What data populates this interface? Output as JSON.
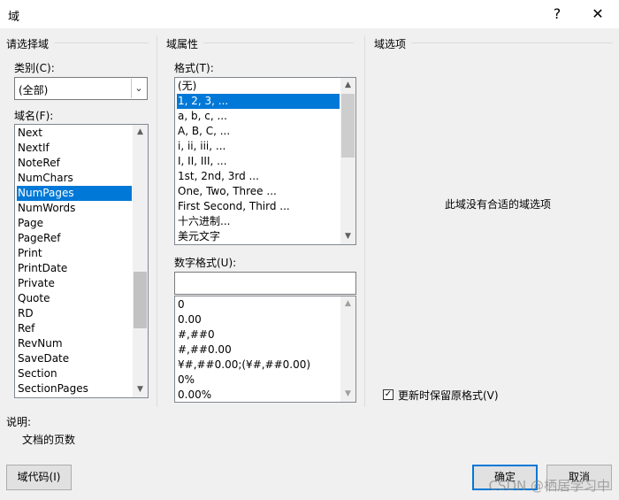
{
  "window": {
    "title": "域",
    "help_glyph": "?",
    "close_glyph": "✕"
  },
  "left": {
    "section_title": "请选择域",
    "category_label": "类别(C):",
    "category_value": "(全部)",
    "fieldname_label": "域名(F):",
    "fields": [
      "Next",
      "NextIf",
      "NoteRef",
      "NumChars",
      "NumPages",
      "NumWords",
      "Page",
      "PageRef",
      "Print",
      "PrintDate",
      "Private",
      "Quote",
      "RD",
      "Ref",
      "RevNum",
      "SaveDate",
      "Section",
      "SectionPages"
    ],
    "selected_field": "NumPages"
  },
  "middle": {
    "section_title": "域属性",
    "format_label": "格式(T):",
    "formats": [
      "(无)",
      "1, 2, 3, ...",
      "a, b, c, ...",
      "A, B, C, ...",
      "i, ii, iii, ...",
      "I, II, III, ...",
      "1st, 2nd, 3rd ...",
      "One, Two, Three ...",
      "First Second, Third ...",
      "十六进制...",
      "美元文字"
    ],
    "selected_format": "1, 2, 3, ...",
    "numformat_label": "数字格式(U):",
    "numformat_value": "",
    "numformats": [
      "0",
      "0.00",
      "#,##0",
      "#,##0.00",
      "¥#,##0.00;(¥#,##0.00)",
      "0%",
      "0.00%"
    ]
  },
  "right": {
    "section_title": "域选项",
    "no_options_text": "此域没有合适的域选项",
    "preserve_format_label": "更新时保留原格式(V)",
    "preserve_format_checked": true
  },
  "description": {
    "label": "说明:",
    "text": "文档的页数"
  },
  "buttons": {
    "field_codes": "域代码(I)",
    "ok": "确定",
    "cancel": "取消"
  },
  "watermark": "CSDN @栖居学习中"
}
